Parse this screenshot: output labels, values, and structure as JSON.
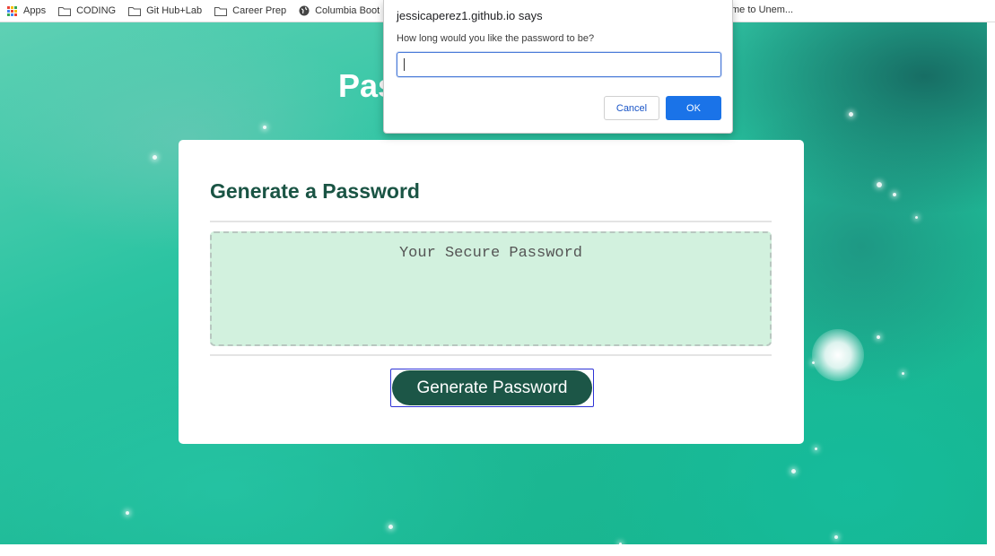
{
  "bookmarks": {
    "items": [
      {
        "label": "Apps",
        "icon": "apps-grid-icon"
      },
      {
        "label": "CODING",
        "icon": "folder-icon"
      },
      {
        "label": "Git Hub+Lab",
        "icon": "folder-icon"
      },
      {
        "label": "Career Prep",
        "icon": "folder-icon"
      },
      {
        "label": "Columbia Boot",
        "icon": "globe-icon"
      }
    ],
    "truncated_right": "me to Unem..."
  },
  "page": {
    "title_visible": "Pas",
    "card": {
      "title": "Generate a Password",
      "password_placeholder": "Your Secure Password",
      "generate_button": "Generate Password"
    }
  },
  "dialog": {
    "title": "jessicaperez1.github.io says",
    "message": "How long would you like the password to be?",
    "input_value": "",
    "cancel_label": "Cancel",
    "ok_label": "OK"
  },
  "colors": {
    "heading": "#1a5444",
    "button": "#1c5647",
    "password_bg": "#d2f1de",
    "ok_button": "#1a73e8",
    "background_teal": "#2bc4a2"
  }
}
